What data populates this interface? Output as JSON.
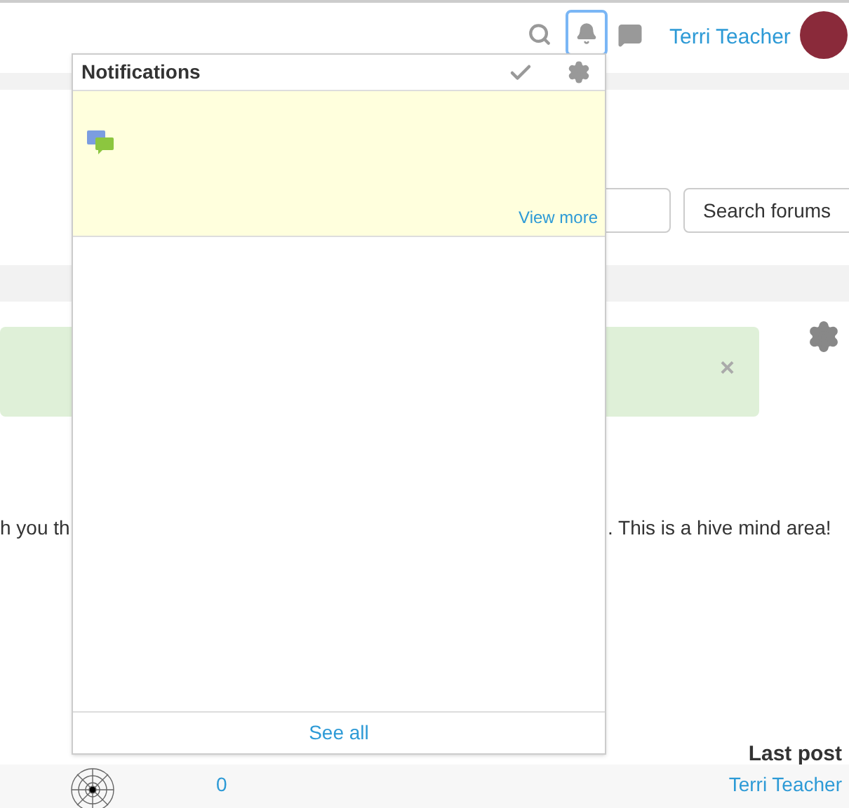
{
  "navbar": {
    "user_name": "Terri Teacher",
    "notifications_open": true
  },
  "search": {
    "button": "Search forums"
  },
  "alert": {
    "close": "×"
  },
  "intro": {
    "left_fragment": "h you th",
    "right_fragment": ". This is a hive mind area!"
  },
  "table": {
    "columns": [
      "Last post"
    ],
    "rows": [
      {
        "replies": "0",
        "last_post_author": "Terri Teacher"
      }
    ]
  },
  "notifications": {
    "title": "Notifications",
    "items": [
      {
        "kind": "message",
        "read": false,
        "link": "View more"
      }
    ],
    "footer": "See all"
  }
}
